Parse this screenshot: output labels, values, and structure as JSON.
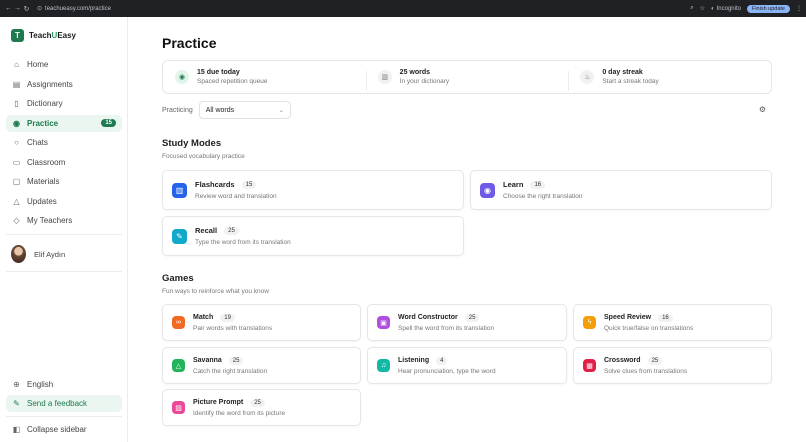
{
  "browser": {
    "url": "teachueasy.com/practice",
    "incognito_label": "Incognito",
    "finish_update_label": "Finish update"
  },
  "brand": {
    "logo_letter": "T",
    "name_prefix": "Teach",
    "name_accent": "U",
    "name_suffix": "Easy"
  },
  "sidebar": {
    "items": [
      {
        "label": "Home",
        "icon": "home-icon"
      },
      {
        "label": "Assignments",
        "icon": "clipboard-icon"
      },
      {
        "label": "Dictionary",
        "icon": "book-icon"
      },
      {
        "label": "Practice",
        "icon": "bulb-icon",
        "active": true,
        "badge": "15"
      },
      {
        "label": "Chats",
        "icon": "chat-icon"
      },
      {
        "label": "Classroom",
        "icon": "monitor-icon"
      },
      {
        "label": "Materials",
        "icon": "document-icon"
      },
      {
        "label": "Updates",
        "icon": "bell-icon"
      },
      {
        "label": "My Teachers",
        "icon": "graduation-cap-icon"
      }
    ],
    "user_name": "Elif Aydın",
    "language": "English",
    "feedback": "Send a feedback",
    "collapse": "Collapse sidebar"
  },
  "main": {
    "title": "Practice",
    "stats": [
      {
        "title": "15 due today",
        "subtitle": "Spaced repetition queue"
      },
      {
        "title": "25 words",
        "subtitle": "In your dictionary"
      },
      {
        "title": "0 day streak",
        "subtitle": "Start a streak today"
      }
    ],
    "practicing_label": "Practicing",
    "practicing_value": "All words",
    "study_modes": {
      "title": "Study Modes",
      "subtitle": "Focused vocabulary practice",
      "cards": [
        {
          "title": "Flashcards",
          "count": "15",
          "desc": "Review word and translation",
          "color": "#2563eb"
        },
        {
          "title": "Learn",
          "count": "16",
          "desc": "Choose the right translation",
          "color": "#6d5be6"
        },
        {
          "title": "Recall",
          "count": "25",
          "desc": "Type the word from its translation",
          "color": "#11a9c9"
        }
      ]
    },
    "games": {
      "title": "Games",
      "subtitle": "Fun ways to reinforce what you know",
      "cards": [
        {
          "title": "Match",
          "count": "19",
          "desc": "Pair words with translations",
          "color": "#f16a24"
        },
        {
          "title": "Word Constructor",
          "count": "25",
          "desc": "Spell the word from its translation",
          "color": "#b14ee0"
        },
        {
          "title": "Speed Review",
          "count": "16",
          "desc": "Quick true/false on translations",
          "color": "#f59e0b"
        },
        {
          "title": "Savanna",
          "count": "25",
          "desc": "Catch the right translation",
          "color": "#22b45a"
        },
        {
          "title": "Listening",
          "count": "4",
          "desc": "Hear pronunciation, type the word",
          "color": "#14b8a6"
        },
        {
          "title": "Crossword",
          "count": "25",
          "desc": "Solve clues from translations",
          "color": "#e11d48"
        },
        {
          "title": "Picture Prompt",
          "count": "25",
          "desc": "Identify the word from its picture",
          "color": "#ec4899"
        }
      ]
    }
  }
}
